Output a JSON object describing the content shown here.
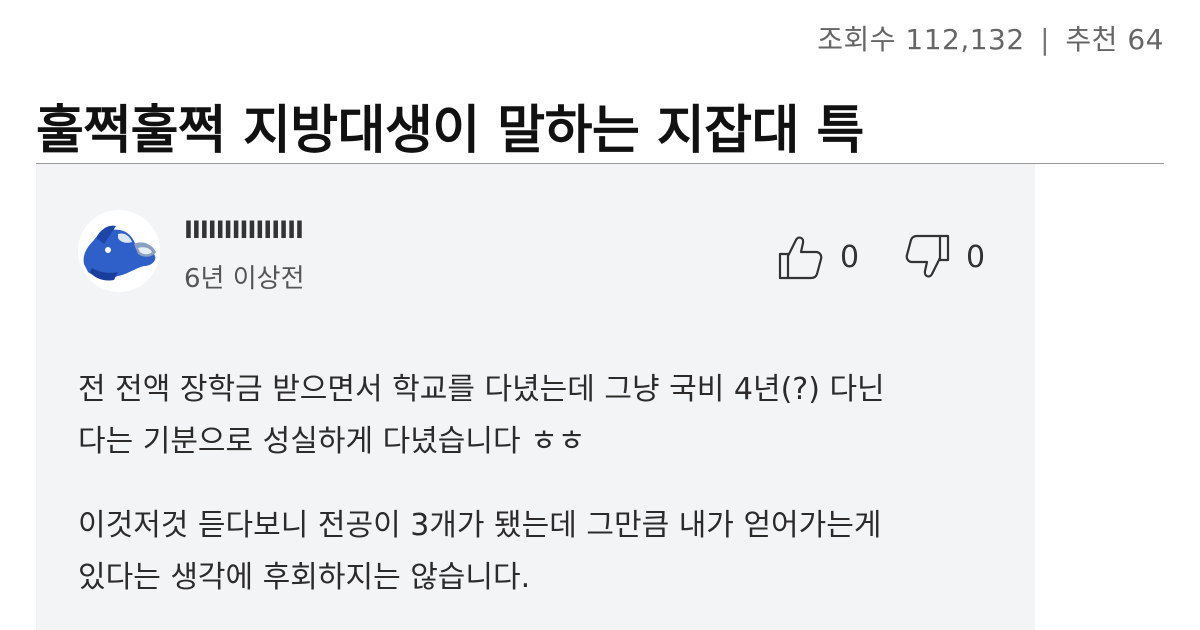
{
  "meta": {
    "views_label": "조회수",
    "views_value": "112,132",
    "separator": "|",
    "recommend_label": "추천",
    "recommend_value": "64"
  },
  "post": {
    "title": "훌쩍훌쩍 지방대생이 말하는 지잡대 특"
  },
  "comment": {
    "username": "IIIIIIIIIIIIIII",
    "time_ago": "6년 이상전",
    "likes": "0",
    "dislikes": "0",
    "like_icon": "thumbs-up-icon",
    "dislike_icon": "thumbs-down-icon",
    "paragraphs": [
      {
        "line1": "전 전액 장학금 받으면서 학교를 다녔는데 그냥 국비 4년(?) 다닌",
        "line2": "다는 기분으로 성실하게 다녔습니다 ㅎㅎ"
      },
      {
        "line1": "이것저것 듣다보니 전공이 3개가 됐는데 그만큼 내가 얻어가는게",
        "line2": "있다는 생각에 후회하지는 않습니다."
      }
    ]
  }
}
